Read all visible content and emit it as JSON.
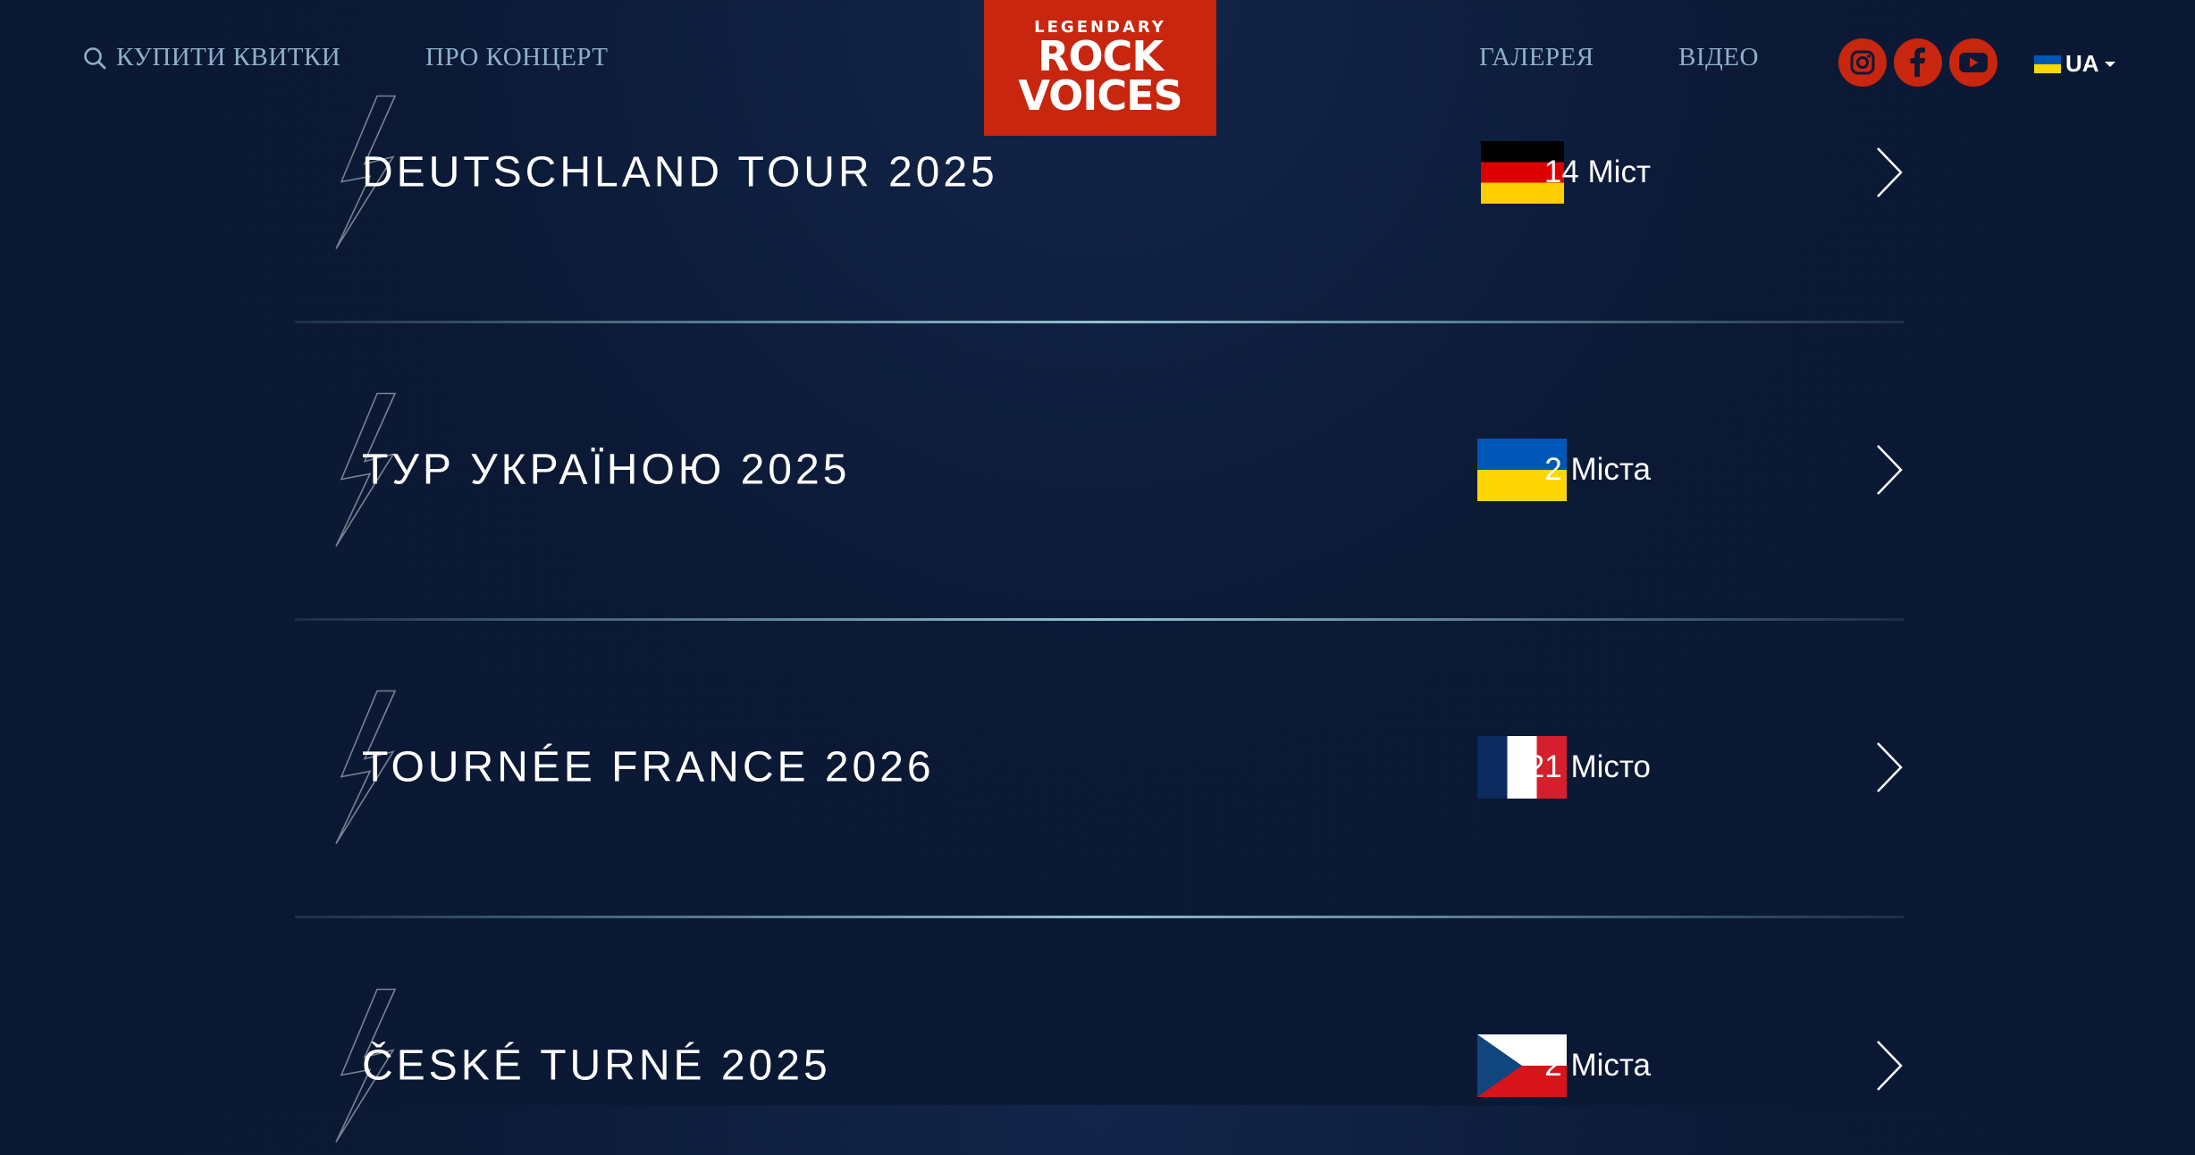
{
  "header": {
    "buy_tickets_label": "КУПИТИ КВИТКИ",
    "about_label": "ПРО КОНЦЕРТ",
    "gallery_label": "ГАЛЕРЕЯ",
    "video_label": "ВІДЕО",
    "logo": {
      "line1": "LEGENDARY",
      "line2": "ROCK",
      "line3": "VOICES"
    },
    "social_icons": [
      "instagram-icon",
      "facebook-icon",
      "youtube-icon"
    ],
    "language": {
      "flag": "ukraine-flag",
      "label": "UA"
    }
  },
  "tours": [
    {
      "title": "DEUTSCHLAND TOUR 2025",
      "flag": "germany-flag",
      "count": "14 Міст"
    },
    {
      "title": "ТУР УКРАЇНОЮ 2025",
      "flag": "ukraine-flag",
      "count": "2 Міста"
    },
    {
      "title": "TOURNÉE FRANCE 2026",
      "flag": "france-flag",
      "count": "21 Місто"
    },
    {
      "title": "ČESKÉ TURNÉ 2025",
      "flag": "czech-flag",
      "count": "2 Міста"
    }
  ],
  "colors": {
    "background": "#0b1935",
    "accent": "#c8260e",
    "nav_text": "#8fb0c9",
    "divider": "#8ec3d0"
  }
}
